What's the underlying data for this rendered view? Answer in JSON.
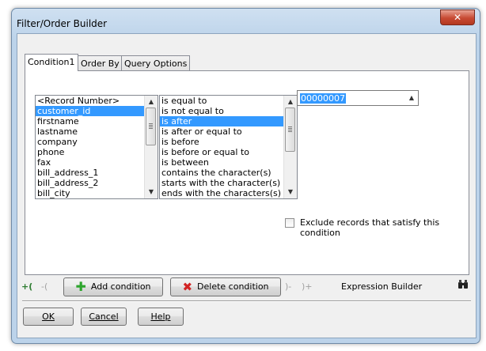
{
  "window": {
    "title": "Filter/Order Builder",
    "close_glyph": "✕"
  },
  "tabs": [
    {
      "label": "Condition1"
    },
    {
      "label": "Order By"
    },
    {
      "label": "Query Options"
    }
  ],
  "fields": {
    "items": [
      "<Record Number>",
      "customer_id",
      "firstname",
      "lastname",
      "company",
      "phone",
      "fax",
      "bill_address_1",
      "bill_address_2",
      "bill_city"
    ],
    "selected": "customer_id"
  },
  "operators": {
    "items": [
      "is equal to",
      "is not equal to",
      "is after",
      "is after or equal to",
      "is before",
      "is before or equal to",
      "is between",
      "contains the character(s)",
      "starts with the character(s)",
      "ends with the characters(s)"
    ],
    "selected": "is after"
  },
  "value_input": {
    "value": "00000007"
  },
  "exclude_checkbox": {
    "label": "Exclude records that satisfy this condition",
    "checked": false
  },
  "toolbar": {
    "add_label": "Add condition",
    "delete_label": "Delete condition",
    "expression_builder_label": "Expression Builder",
    "open_paren": "+(",
    "open_paren_disabled": "-(",
    "close_paren_disabled": ")-",
    "close_paren": ")+"
  },
  "icons": {
    "add": "plus-icon",
    "delete": "delete-x-icon",
    "binoculars": "binoculars-icon"
  },
  "colors": {
    "add_icon": "#2ea52e",
    "delete_icon": "#d22323",
    "selection": "#3399ff"
  },
  "buttons": {
    "ok": "OK",
    "cancel": "Cancel",
    "help": "Help"
  }
}
